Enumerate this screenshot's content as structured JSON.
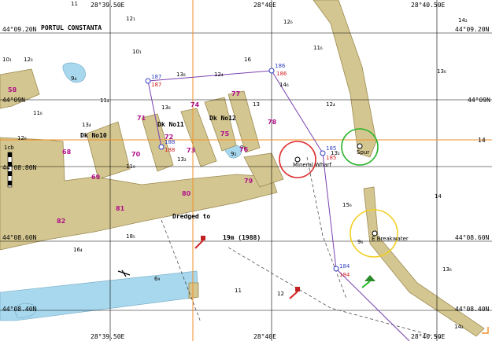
{
  "colors": {
    "land": "#d4c690",
    "land_edge": "#9c8a52",
    "water_shallow": "#a8d8ee",
    "grid": "#000000",
    "crosshair": "#f0902a",
    "route": "#7a3fb0",
    "waypoint_upper": "#2f3fc0",
    "waypoint_lower": "#d02020",
    "depth_magenta": "#b0108a",
    "circle_red": "#e03030",
    "circle_green": "#2ab52a",
    "circle_yellow": "#f0d020"
  },
  "longitude_labels": {
    "top": [
      "28°39.50E",
      "28°40E",
      "28°40.50E"
    ],
    "bottom": [
      "28°39.50E",
      "28°40E",
      "28°40.50E"
    ]
  },
  "latitude_labels": {
    "left": [
      "44°09.20N",
      "44°09N",
      "44°08.80N",
      "44°08.60N",
      "44°08.40N"
    ],
    "right": [
      "44°09.20N",
      "44°09N",
      "14",
      "44°08.60N",
      "44°08.40N"
    ]
  },
  "place_names": {
    "port": "PORTUL CONSTANTA",
    "dock10": "Dk No10",
    "dock11": "Dk No11",
    "dock12": "Dk No12",
    "mineral_wharf": "Mineral Wharf",
    "spur": "Spur",
    "breakwater": "E Breakwater",
    "dredged": "Dredged to",
    "dredged_depth": "19m (1988)"
  },
  "scale_label": "1cb",
  "depth_soundings": [
    {
      "id": "d1",
      "text": "11"
    },
    {
      "id": "d2",
      "text": "12₁"
    },
    {
      "id": "d3",
      "text": "12₆"
    },
    {
      "id": "d4",
      "text": "14₂"
    },
    {
      "id": "d5",
      "text": "10₁"
    },
    {
      "id": "d6",
      "text": "12₆"
    },
    {
      "id": "d7",
      "text": "10₁"
    },
    {
      "id": "d8",
      "text": "16"
    },
    {
      "id": "d9",
      "text": "11₆"
    },
    {
      "id": "d10",
      "text": "13₆"
    },
    {
      "id": "d11",
      "text": "9₄"
    },
    {
      "id": "d12",
      "text": "13₈"
    },
    {
      "id": "d13",
      "text": "12₄"
    },
    {
      "id": "d14",
      "text": "14₆"
    },
    {
      "id": "d15",
      "text": "11₄"
    },
    {
      "id": "d16",
      "text": "13₈"
    },
    {
      "id": "d17",
      "text": "13"
    },
    {
      "id": "d18",
      "text": "12₄"
    },
    {
      "id": "d19",
      "text": "11₆"
    },
    {
      "id": "d20",
      "text": "13₄"
    },
    {
      "id": "d21",
      "text": "12₆"
    },
    {
      "id": "d22",
      "text": "9₂"
    },
    {
      "id": "d23",
      "text": "13₂"
    },
    {
      "id": "d24",
      "text": "13₂"
    },
    {
      "id": "d25",
      "text": "11₉"
    },
    {
      "id": "d26",
      "text": "14"
    },
    {
      "id": "d27",
      "text": "15₆"
    },
    {
      "id": "d28",
      "text": "18₅"
    },
    {
      "id": "d29",
      "text": "16₄"
    },
    {
      "id": "d30",
      "text": "6₉"
    },
    {
      "id": "d31",
      "text": "11"
    },
    {
      "id": "d32",
      "text": "12"
    },
    {
      "id": "d33",
      "text": "13₆"
    },
    {
      "id": "d34",
      "text": "14₂"
    },
    {
      "id": "d35",
      "text": "9₆"
    },
    {
      "id": "d36",
      "text": "9₈"
    }
  ],
  "harbour_depths": [
    {
      "id": "m1",
      "text": "58"
    },
    {
      "id": "m2",
      "text": "74"
    },
    {
      "id": "m3",
      "text": "77"
    },
    {
      "id": "m4",
      "text": "71"
    },
    {
      "id": "m5",
      "text": "78"
    },
    {
      "id": "m6",
      "text": "72"
    },
    {
      "id": "m7",
      "text": "75"
    },
    {
      "id": "m8",
      "text": "76"
    },
    {
      "id": "m9",
      "text": "68"
    },
    {
      "id": "m10",
      "text": "70"
    },
    {
      "id": "m11",
      "text": "73"
    },
    {
      "id": "m12",
      "text": "69"
    },
    {
      "id": "m13",
      "text": "79"
    },
    {
      "id": "m14",
      "text": "80"
    },
    {
      "id": "m15",
      "text": "81"
    },
    {
      "id": "m16",
      "text": "82"
    }
  ],
  "waypoints": [
    {
      "id": "w187",
      "upper": "187",
      "lower": "187"
    },
    {
      "id": "w186",
      "upper": "186",
      "lower": "186"
    },
    {
      "id": "w188",
      "upper": "188",
      "lower": "188"
    },
    {
      "id": "w185",
      "upper": "185",
      "lower": "185"
    },
    {
      "id": "w184",
      "upper": "184",
      "lower": "184"
    }
  ]
}
